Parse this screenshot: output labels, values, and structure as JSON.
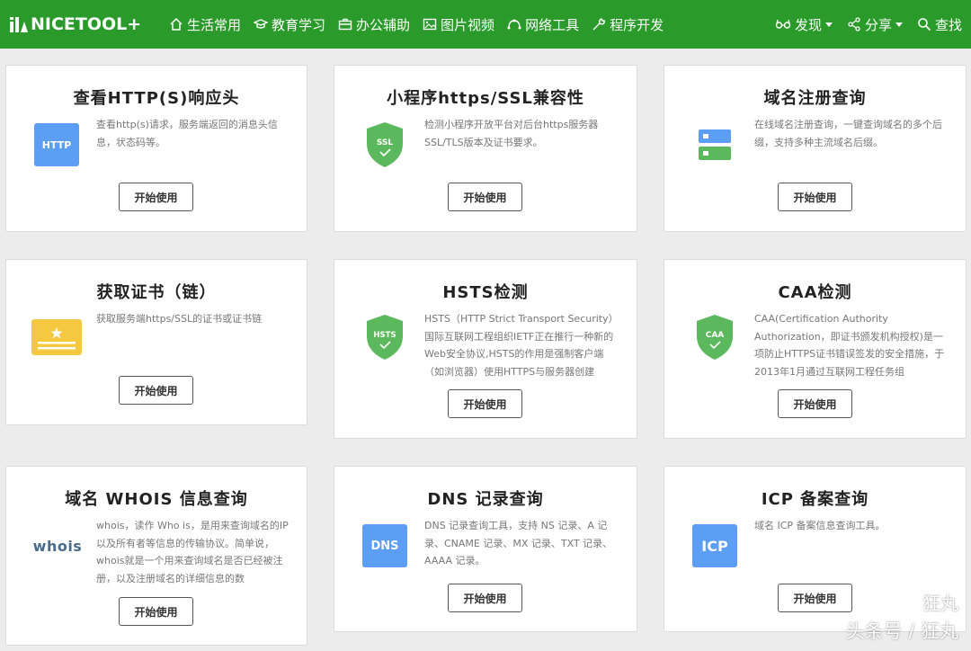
{
  "nav": {
    "brand": "NICETOOL+",
    "items": [
      "生活常用",
      "教育学习",
      "办公辅助",
      "图片视频",
      "网络工具",
      "程序开发"
    ],
    "discover": "发现",
    "share": "分享",
    "search": "查找"
  },
  "cards": [
    {
      "title": "查看HTTP(S)响应头",
      "desc": "查看http(s)请求，服务端返回的消息头信息，状态码等。",
      "icon": "HTTP",
      "button": "开始使用"
    },
    {
      "title": "小程序https/SSL兼容性",
      "desc": "检测小程序开放平台对后台https服务器SSL/TLS版本及证书要求。",
      "icon": "SSL",
      "button": "开始使用"
    },
    {
      "title": "域名注册查询",
      "desc": "在线域名注册查询，一键查询域名的多个后缀，支持多种主流域名后缀。",
      "icon": "server-icon",
      "button": "开始使用"
    },
    {
      "title": "获取证书（链）",
      "desc": "获取服务端https/SSL的证书或证书链",
      "icon": "certificate-icon",
      "button": "开始使用"
    },
    {
      "title": "HSTS检测",
      "desc": "HSTS（HTTP Strict Transport Security）国际互联网工程组织IETF正在推行一种新的Web安全协议,HSTS的作用是强制客户端（如浏览器）使用HTTPS与服务器创建",
      "icon": "HSTS",
      "button": "开始使用"
    },
    {
      "title": "CAA检测",
      "desc": "CAA(Certification Authority Authorization，即证书颁发机构授权)是一项防止HTTPS证书错误签发的安全措施，于2013年1月通过互联网工程任务组",
      "icon": "CAA",
      "button": "开始使用"
    },
    {
      "title": "域名 WHOIS 信息查询",
      "desc": "whois，读作 Who is，是用来查询域名的IP以及所有者等信息的传输协议。简单说，whois就是一个用来查询域名是否已经被注册，以及注册域名的详细信息的数",
      "icon": "whois",
      "button": "开始使用"
    },
    {
      "title": "DNS 记录查询",
      "desc": "DNS 记录查询工具，支持 NS 记录、A 记录、CNAME 记录、MX 记录、TXT 记录、AAAA 记录。",
      "icon": "DNS",
      "button": "开始使用"
    },
    {
      "title": "ICP 备案查询",
      "desc": "域名 ICP 备案信息查询工具。",
      "icon": "ICP",
      "button": "开始使用"
    }
  ],
  "watermark": {
    "line1": "狂丸",
    "line2": "头条号 / 狂丸"
  },
  "colors": {
    "nav_bg": "#2a9b2a",
    "blue_icon": "#5b9ef4",
    "green_shield": "#5cb85c",
    "yellow_cert": "#f5c842"
  }
}
